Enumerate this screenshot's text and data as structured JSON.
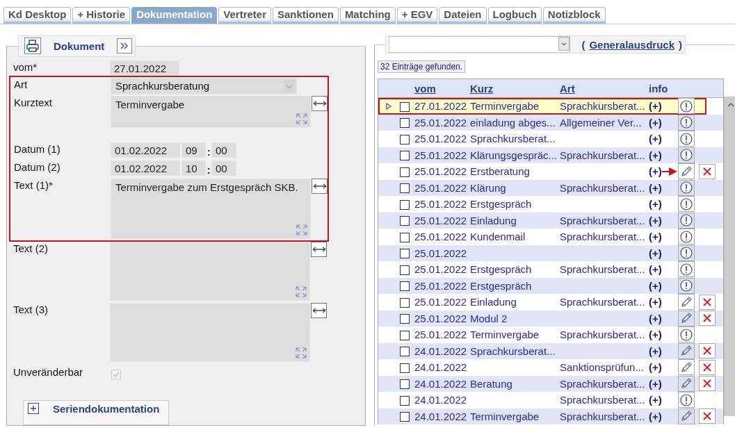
{
  "tabs": [
    {
      "label": "Kd Desktop",
      "selected": false
    },
    {
      "label": "+ Historie",
      "selected": false
    },
    {
      "label": "Dokumentation",
      "selected": true
    },
    {
      "label": "Vertreter",
      "selected": false
    },
    {
      "label": "Sanktionen",
      "selected": false
    },
    {
      "label": "Matching",
      "selected": false
    },
    {
      "label": "+ EGV",
      "selected": false
    },
    {
      "label": "Dateien",
      "selected": false
    },
    {
      "label": "Logbuch",
      "selected": false
    },
    {
      "label": "Notizblock",
      "selected": false
    }
  ],
  "form": {
    "legend": "Dokument",
    "highlighted": true,
    "vom": {
      "label": "vom*",
      "value": "27.01.2022"
    },
    "art": {
      "label": "Art",
      "value": "Sprachkursberatung"
    },
    "kurztext": {
      "label": "Kurztext",
      "value": "Terminvergabe"
    },
    "dates": [
      {
        "label": "Datum (1)",
        "date": "01.02.2022",
        "hour": "09",
        "separator": ":",
        "minute": "00"
      },
      {
        "label": "Datum (2)",
        "date": "01.02.2022",
        "hour": "10",
        "separator": ":",
        "minute": "00"
      }
    ],
    "text1": {
      "label": "Text (1)*",
      "value": "Terminvergabe zum Erstgespräch SKB."
    },
    "texts": [
      {
        "label": "Text (2)"
      },
      {
        "label": "Text (3)"
      }
    ],
    "unveraenderbar": {
      "label": "Unveränderbar",
      "checked": true
    },
    "serien": {
      "label": "Seriendokumentation",
      "expanded": false
    }
  },
  "list": {
    "link_open": "(",
    "link": "Generalausdruck",
    "link_close": ")",
    "count": "32 Einträge gefunden.",
    "columns": [
      {
        "label": "vom",
        "sortable": true
      },
      {
        "label": "Kurz",
        "sortable": true
      },
      {
        "label": "Art",
        "sortable": true
      },
      {
        "label": "info",
        "sortable": false
      }
    ],
    "rows": [
      {
        "date": "27.01.2022",
        "kurz": "Terminvergabe",
        "art": "Sprachkursberat...",
        "info": "(+)",
        "kind": "info",
        "selected": true,
        "checked": false,
        "expandable": true,
        "highlighted": true,
        "arrow": false
      },
      {
        "date": "25.01.2022",
        "kurz": "einladung abges...",
        "art": "Allgemeiner Ver...",
        "info": "(+)",
        "kind": "info",
        "selected": false,
        "checked": false,
        "expandable": false,
        "highlighted": false,
        "arrow": false
      },
      {
        "date": "25.01.2022",
        "kurz": "Sprachkursberat...",
        "info": "(+)",
        "kind": "info",
        "selected": false,
        "checked": false,
        "expandable": false,
        "highlighted": false,
        "arrow": false
      },
      {
        "date": "25.01.2022",
        "kurz": "Klärungsgespräc...",
        "art": "Sprachkursberat...",
        "info": "(+)",
        "kind": "info",
        "selected": false,
        "checked": false,
        "expandable": false,
        "highlighted": false,
        "arrow": false
      },
      {
        "date": "25.01.2022",
        "kurz": "Erstberatung",
        "info": "(+)",
        "kind": "edit",
        "selected": false,
        "checked": false,
        "expandable": false,
        "highlighted": false,
        "arrow": true
      },
      {
        "date": "25.01.2022",
        "kurz": "Klärung",
        "art": "Sprachkursberat...",
        "info": "(+)",
        "kind": "info",
        "selected": false,
        "checked": false,
        "expandable": false,
        "highlighted": false,
        "arrow": false
      },
      {
        "date": "25.01.2022",
        "kurz": "Erstgespräch",
        "info": "(+)",
        "kind": "info",
        "selected": false,
        "checked": false,
        "expandable": false,
        "highlighted": false,
        "arrow": false
      },
      {
        "date": "25.01.2022",
        "kurz": "Einladung",
        "art": "Sprachkursberat...",
        "info": "(+)",
        "kind": "info",
        "selected": false,
        "checked": false,
        "expandable": false,
        "highlighted": false,
        "arrow": false
      },
      {
        "date": "25.01.2022",
        "kurz": "Kundenmail",
        "art": "Sprachkursberat...",
        "info": "(+)",
        "kind": "info",
        "selected": false,
        "checked": false,
        "expandable": false,
        "highlighted": false,
        "arrow": false
      },
      {
        "date": "25.01.2022",
        "info": "(+)",
        "kind": "info",
        "selected": false,
        "checked": false,
        "expandable": false,
        "highlighted": false,
        "arrow": false
      },
      {
        "date": "25.01.2022",
        "kurz": "Erstgespräch",
        "art": "Sprachkursberat...",
        "info": "(+)",
        "kind": "info",
        "selected": false,
        "checked": false,
        "expandable": false,
        "highlighted": false,
        "arrow": false
      },
      {
        "date": "25.01.2022",
        "kurz": "Erstgespräch",
        "info": "(+)",
        "kind": "info",
        "selected": false,
        "checked": false,
        "expandable": false,
        "highlighted": false,
        "arrow": false
      },
      {
        "date": "25.01.2022",
        "kurz": "Einladung",
        "art": "Sprachkursberat...",
        "info": "(+)",
        "kind": "edit",
        "selected": false,
        "checked": false,
        "expandable": false,
        "highlighted": false,
        "arrow": false
      },
      {
        "date": "25.01.2022",
        "kurz": "Modul 2",
        "info": "(+)",
        "kind": "edit",
        "selected": false,
        "checked": false,
        "expandable": false,
        "highlighted": false,
        "arrow": false
      },
      {
        "date": "25.01.2022",
        "kurz": "Terminvergabe",
        "art": "Sprachkursberat...",
        "info": "(+)",
        "kind": "info",
        "selected": false,
        "checked": false,
        "expandable": false,
        "highlighted": false,
        "arrow": false
      },
      {
        "date": "24.01.2022",
        "kurz": "Sprachkursberat...",
        "info": "(+)",
        "kind": "edit",
        "selected": false,
        "checked": false,
        "expandable": false,
        "highlighted": false,
        "arrow": false
      },
      {
        "date": "24.01.2022",
        "art": "Sanktionsprüfun...",
        "info": "(+)",
        "kind": "edit",
        "selected": false,
        "checked": false,
        "expandable": false,
        "highlighted": false,
        "arrow": false
      },
      {
        "date": "24.01.2022",
        "kurz": "Beratung",
        "art": "Sprachkursberat...",
        "info": "(+)",
        "kind": "edit",
        "selected": false,
        "checked": false,
        "expandable": false,
        "highlighted": false,
        "arrow": false
      },
      {
        "date": "24.01.2022",
        "art": "Sprachkursberat...",
        "info": "(+)",
        "kind": "info",
        "selected": false,
        "checked": false,
        "expandable": false,
        "highlighted": false,
        "arrow": false
      },
      {
        "date": "24.01.2022",
        "kurz": "Terminvergabe",
        "art": "Sprachkursberat...",
        "info": "(+)",
        "kind": "edit",
        "selected": false,
        "checked": false,
        "expandable": false,
        "highlighted": false,
        "arrow": false
      }
    ]
  }
}
